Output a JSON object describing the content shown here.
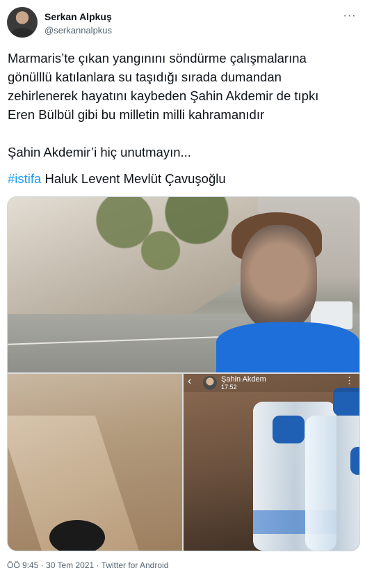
{
  "user": {
    "name": "Serkan Alpkuş",
    "handle": "@serkannalpkus"
  },
  "more_icon": "···",
  "tweet": {
    "text": "Marmaris’te çıkan yangınını söndürme çalışmalarına\ngönülllü katılanlara su taşıdığı sırada dumandan\nzehirlenerek hayatını kaybeden Şahin Akdemir de tıpkı\nEren Bülbül gibi bu milletin milli kahramanıdır\n\nŞahin Akdemir’i hiç unutmayın...",
    "hashtag": "#istifa",
    "after_hashtag": " Haluk Levent Mevlüt Çavuşoğlu"
  },
  "story": {
    "back_icon": "‹",
    "name": "Şahin Akdem",
    "time": "17:52",
    "more": "⋮"
  },
  "footer": {
    "time": "ÖÖ 9:45",
    "separator1": " · ",
    "date": "30 Tem 2021",
    "separator2": " · ",
    "source": "Twitter for Android"
  },
  "colors": {
    "accent": "#1d9bf0",
    "text": "#0f1419",
    "secondary": "#536471"
  },
  "icons": {
    "more": "more-horizontal-icon",
    "back": "chevron-left-icon",
    "story_more": "more-vertical-icon"
  }
}
